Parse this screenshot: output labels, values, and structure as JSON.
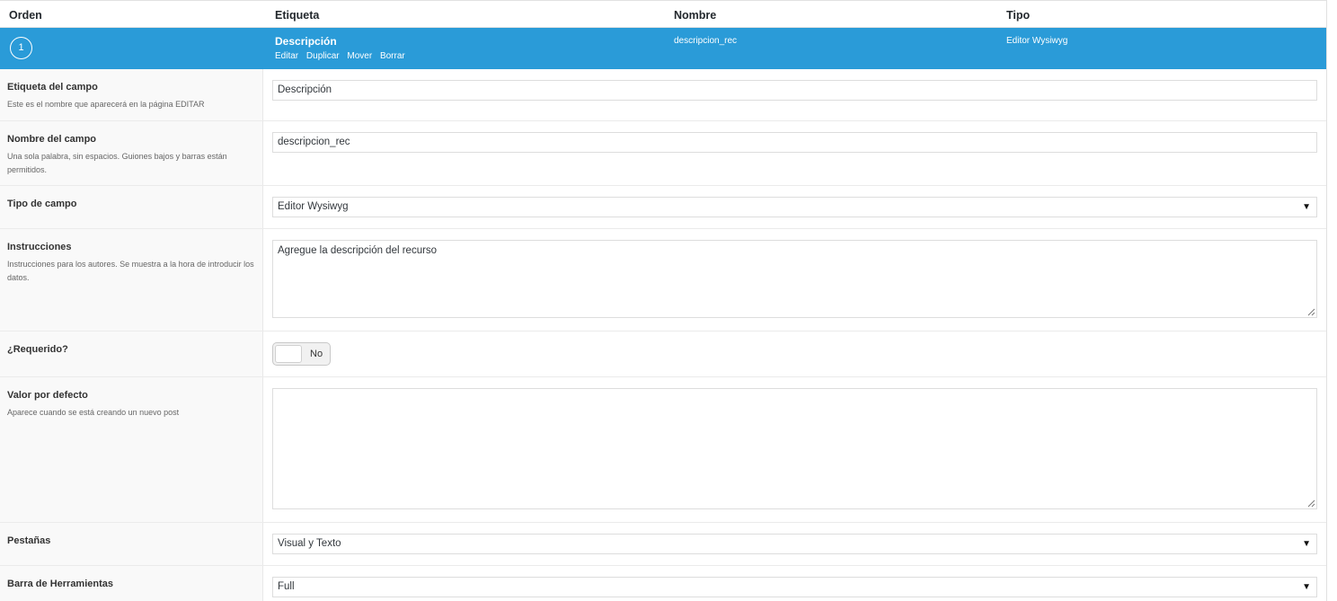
{
  "header": {
    "col_order": "Orden",
    "col_label": "Etiqueta",
    "col_name": "Nombre",
    "col_type": "Tipo"
  },
  "field": {
    "order": "1",
    "label": "Descripción",
    "actions": [
      "Editar",
      "Duplicar",
      "Mover",
      "Borrar"
    ],
    "name": "descripcion_rec",
    "type": "Editor Wysiwyg"
  },
  "settings": {
    "label": {
      "title": "Etiqueta del campo",
      "desc": "Este es el nombre que aparecerá en la página EDITAR",
      "value": "Descripción"
    },
    "name": {
      "title": "Nombre del campo",
      "desc": "Una sola palabra, sin espacios. Guiones bajos y barras están permitidos.",
      "value": "descripcion_rec"
    },
    "type": {
      "title": "Tipo de campo",
      "value": "Editor Wysiwyg"
    },
    "instructions": {
      "title": "Instrucciones",
      "desc": "Instrucciones para los autores. Se muestra a la hora de introducir los datos.",
      "value": "Agregue la descripción del recurso"
    },
    "required": {
      "title": "¿Requerido?",
      "value": "No"
    },
    "default": {
      "title": "Valor por defecto",
      "desc": "Aparece cuando se está creando un nuevo post",
      "value": ""
    },
    "tabs": {
      "title": "Pestañas",
      "value": "Visual y Texto"
    },
    "toolbar": {
      "title": "Barra de Herramientas",
      "value": "Full"
    }
  },
  "colors": {
    "accent": "#2a9bd8",
    "label_bg": "#f9f9f9",
    "border": "#dddddd"
  }
}
